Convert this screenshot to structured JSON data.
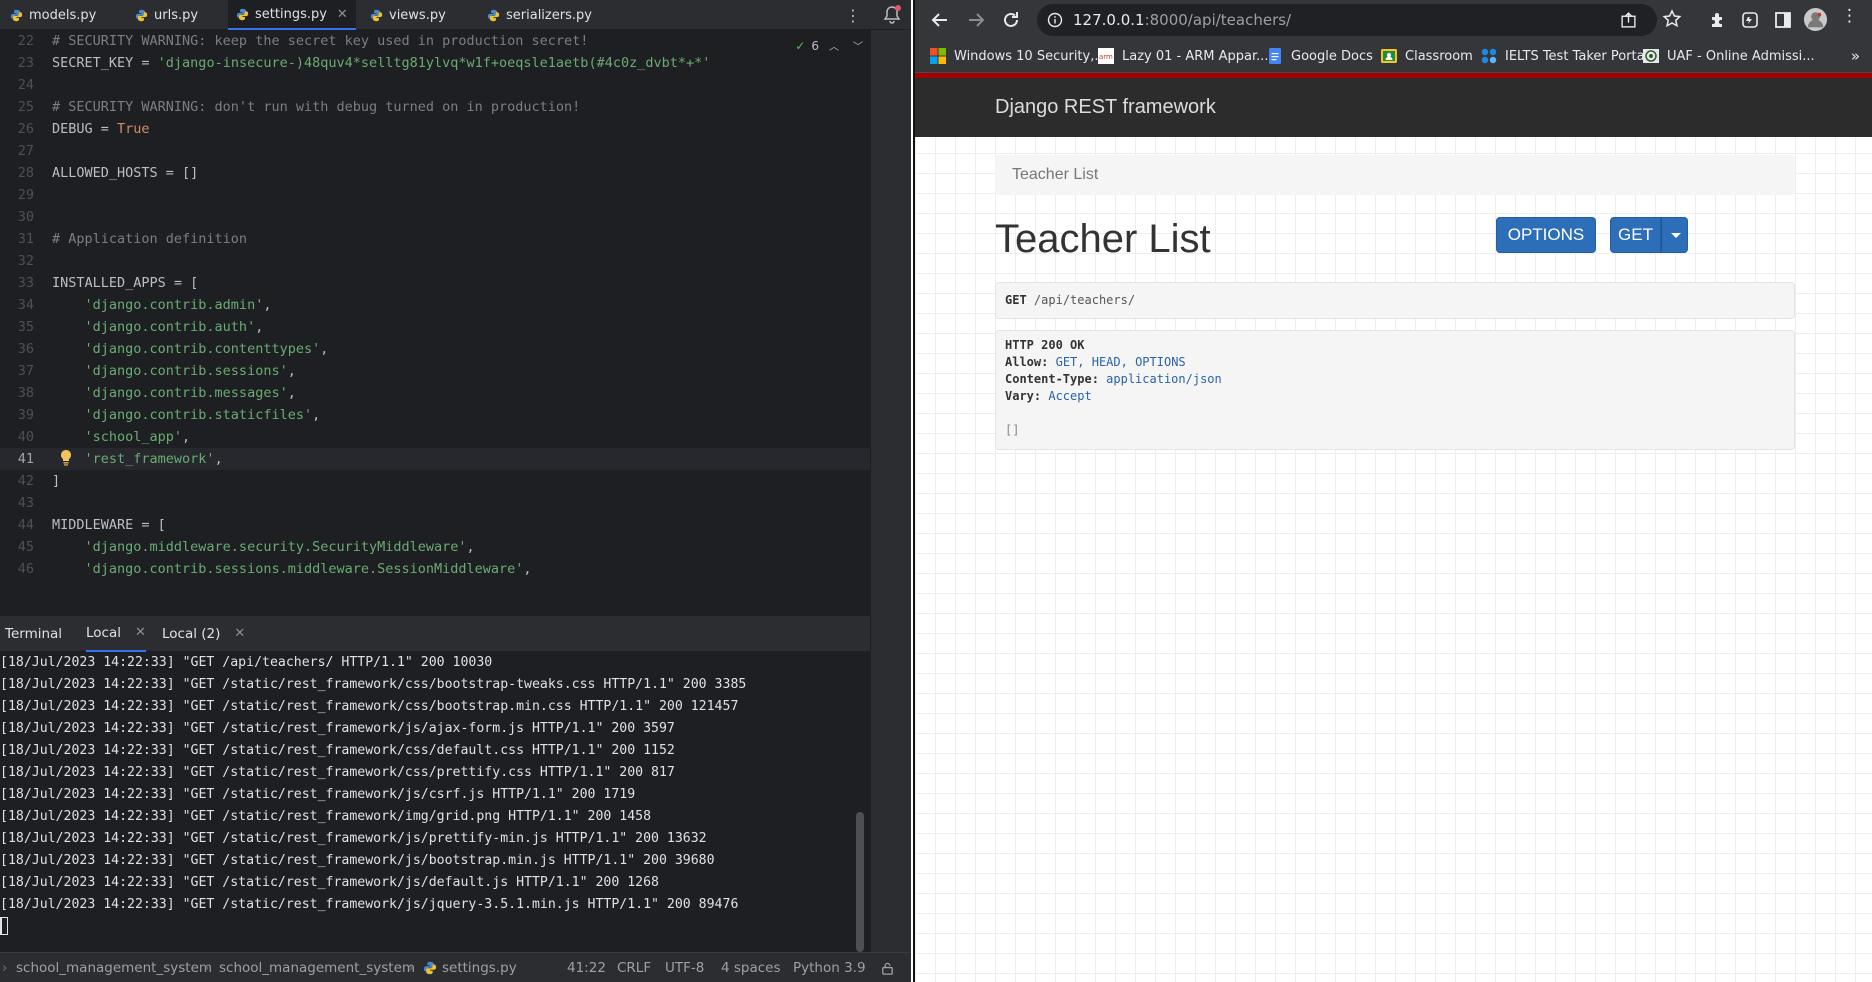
{
  "ide": {
    "tabs": [
      {
        "label": "models.py",
        "active": false
      },
      {
        "label": "urls.py",
        "active": false
      },
      {
        "label": "settings.py",
        "active": true
      },
      {
        "label": "views.py",
        "active": false
      },
      {
        "label": "serializers.py",
        "active": false
      }
    ],
    "inspection_count": "6",
    "code_lines": [
      {
        "n": "22",
        "text": "# SECURITY WARNING: keep the secret key used in production secret!",
        "kind": "comment"
      },
      {
        "n": "23",
        "pre": "SECRET_KEY = ",
        "str": "'django-insecure-)48quv4*selltg81ylvq*w1f+oeqsle1aetb(#4c0z_dvbt*+*'",
        "kind": "assign"
      },
      {
        "n": "24",
        "text": "",
        "kind": "plain"
      },
      {
        "n": "25",
        "text": "# SECURITY WARNING: don't run with debug turned on in production!",
        "kind": "comment"
      },
      {
        "n": "26",
        "pre": "DEBUG = ",
        "kw": "True",
        "kind": "kwassign"
      },
      {
        "n": "27",
        "text": "",
        "kind": "plain"
      },
      {
        "n": "28",
        "text": "ALLOWED_HOSTS = []",
        "kind": "plain"
      },
      {
        "n": "29",
        "text": "",
        "kind": "plain"
      },
      {
        "n": "30",
        "text": "",
        "kind": "plain"
      },
      {
        "n": "31",
        "text": "# Application definition",
        "kind": "comment"
      },
      {
        "n": "32",
        "text": "",
        "kind": "plain"
      },
      {
        "n": "33",
        "text": "INSTALLED_APPS = [",
        "kind": "plain"
      },
      {
        "n": "34",
        "str": "    'django.contrib.admin'",
        "post": ",",
        "kind": "strline"
      },
      {
        "n": "35",
        "str": "    'django.contrib.auth'",
        "post": ",",
        "kind": "strline"
      },
      {
        "n": "36",
        "str": "    'django.contrib.contenttypes'",
        "post": ",",
        "kind": "strline"
      },
      {
        "n": "37",
        "str": "    'django.contrib.sessions'",
        "post": ",",
        "kind": "strline"
      },
      {
        "n": "38",
        "str": "    'django.contrib.messages'",
        "post": ",",
        "kind": "strline"
      },
      {
        "n": "39",
        "str": "    'django.contrib.staticfiles'",
        "post": ",",
        "kind": "strline"
      },
      {
        "n": "40",
        "str": "    'school_app'",
        "post": ",",
        "kind": "strline"
      },
      {
        "n": "41",
        "str": "    'rest_framework'",
        "post": ",",
        "kind": "strline",
        "current": true
      },
      {
        "n": "42",
        "text": "]",
        "kind": "plain"
      },
      {
        "n": "43",
        "text": "",
        "kind": "plain"
      },
      {
        "n": "44",
        "text": "MIDDLEWARE = [",
        "kind": "plain"
      },
      {
        "n": "45",
        "str": "    'django.middleware.security.SecurityMiddleware'",
        "post": ",",
        "kind": "strline"
      },
      {
        "n": "46",
        "str": "    'django.contrib.sessions.middleware.SessionMiddleware'",
        "post": ",",
        "kind": "strline"
      }
    ],
    "terminal": {
      "title": "Terminal",
      "tabs": [
        {
          "label": "Local",
          "active": true
        },
        {
          "label": "Local (2)",
          "active": false
        }
      ],
      "lines": [
        "[18/Jul/2023 14:22:33] \"GET /api/teachers/ HTTP/1.1\" 200 10030",
        "[18/Jul/2023 14:22:33] \"GET /static/rest_framework/css/bootstrap-tweaks.css HTTP/1.1\" 200 3385",
        "[18/Jul/2023 14:22:33] \"GET /static/rest_framework/css/bootstrap.min.css HTTP/1.1\" 200 121457",
        "[18/Jul/2023 14:22:33] \"GET /static/rest_framework/js/ajax-form.js HTTP/1.1\" 200 3597",
        "[18/Jul/2023 14:22:33] \"GET /static/rest_framework/css/default.css HTTP/1.1\" 200 1152",
        "[18/Jul/2023 14:22:33] \"GET /static/rest_framework/css/prettify.css HTTP/1.1\" 200 817",
        "[18/Jul/2023 14:22:33] \"GET /static/rest_framework/js/csrf.js HTTP/1.1\" 200 1719",
        "[18/Jul/2023 14:22:33] \"GET /static/rest_framework/img/grid.png HTTP/1.1\" 200 1458",
        "[18/Jul/2023 14:22:33] \"GET /static/rest_framework/js/prettify-min.js HTTP/1.1\" 200 13632",
        "[18/Jul/2023 14:22:33] \"GET /static/rest_framework/js/bootstrap.min.js HTTP/1.1\" 200 39680",
        "[18/Jul/2023 14:22:33] \"GET /static/rest_framework/js/default.js HTTP/1.1\" 200 1268",
        "[18/Jul/2023 14:22:33] \"GET /static/rest_framework/js/jquery-3.5.1.min.js HTTP/1.1\" 200 89476"
      ]
    },
    "statusbar": {
      "crumbs": [
        "school_management_system",
        "school_management_system",
        "settings.py"
      ],
      "position": "41:22",
      "line_ending": "CRLF",
      "encoding": "UTF-8",
      "indent": "4 spaces",
      "interpreter": "Python 3.9"
    }
  },
  "browser": {
    "url_host": "127.0.0.1",
    "url_path": ":8000/api/teachers/",
    "bookmarks": [
      {
        "label": "Windows 10 Security,...",
        "icon": "microsoft-icon"
      },
      {
        "label": "Lazy 01 - ARM Appar...",
        "icon": "arm-icon"
      },
      {
        "label": "Google Docs",
        "icon": "google-docs-icon"
      },
      {
        "label": "Classroom",
        "icon": "classroom-icon"
      },
      {
        "label": "IELTS Test Taker Portal",
        "icon": "ielts-icon"
      },
      {
        "label": "UAF - Online Admissi...",
        "icon": "uaf-icon"
      }
    ],
    "page": {
      "brand": "Django REST framework",
      "breadcrumb": "Teacher List",
      "title": "Teacher List",
      "options_button": "OPTIONS",
      "get_button": "GET",
      "request_method": "GET",
      "request_path": "/api/teachers/",
      "status": "HTTP 200 OK",
      "headers": [
        {
          "name": "Allow:",
          "value": "GET, HEAD, OPTIONS"
        },
        {
          "name": "Content-Type:",
          "value": "application/json"
        },
        {
          "name": "Vary:",
          "value": "Accept"
        }
      ],
      "body": "[]"
    }
  },
  "colors": {
    "ide_bg": "#1e1f22",
    "ide_panel": "#2b2d30",
    "comment": "#7a7e85",
    "string": "#6aab73",
    "keyword": "#cf8e6d",
    "accent": "#3574f0",
    "drf_red": "#a30000",
    "drf_button": "#2c6eb7"
  }
}
